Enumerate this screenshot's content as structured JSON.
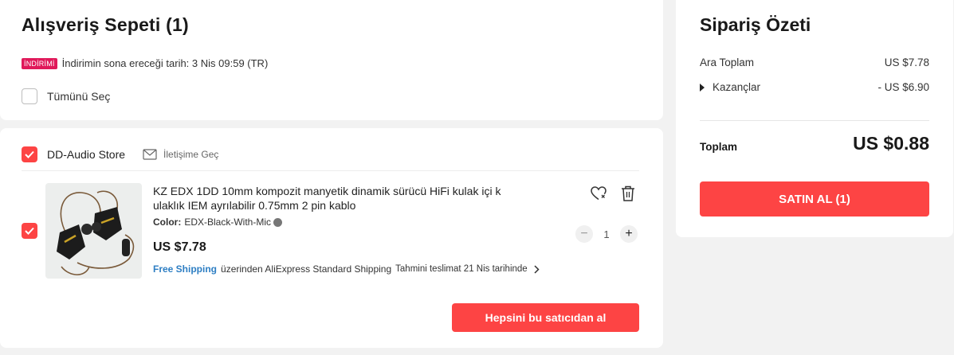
{
  "cart": {
    "title": "Alışveriş Sepeti (1)",
    "discount_badge": "İNDİRİMİ",
    "discount_text": "İndirimin sona ereceği tarih: 3 Nis 09:59 (TR)",
    "select_all_label": "Tümünü Seç",
    "select_all_checked": false
  },
  "store": {
    "name": "DD-Audio Store",
    "checked": true,
    "contact_label": "İletişime Geç",
    "buy_all_label": "Hepsini bu satıcıdan al",
    "item": {
      "checked": true,
      "title": "KZ EDX 1DD 10mm kompozit manyetik dinamik sürücü HiFi kulak içi k ulaklık IEM ayrılabilir 0.75mm 2 pin kablo",
      "color_label": "Color:",
      "color_value": "EDX-Black-With-Mic",
      "price": "US $7.78",
      "free_shipping": "Free Shipping",
      "shipping_via": "üzerinden AliExpress Standard Shipping",
      "eta": "Tahmini teslimat 21 Nis tarihinde",
      "quantity": "1",
      "icons": [
        "wishlist-heart-icon",
        "trash-icon",
        "minus-icon",
        "plus-icon",
        "chevron-right-icon",
        "mail-icon"
      ]
    }
  },
  "summary": {
    "title": "Sipariş Özeti",
    "subtotal_label": "Ara Toplam",
    "subtotal_value": "US $7.78",
    "savings_label": "Kazançlar",
    "savings_value": "- US $6.90",
    "total_label": "Toplam",
    "total_value": "US $0.88",
    "checkout_label": "SATIN AL (1)"
  },
  "colors": {
    "accent": "#fd4444",
    "discount_badge": "#e0195a",
    "link": "#2d7ec3",
    "background": "#f2f2f2"
  }
}
